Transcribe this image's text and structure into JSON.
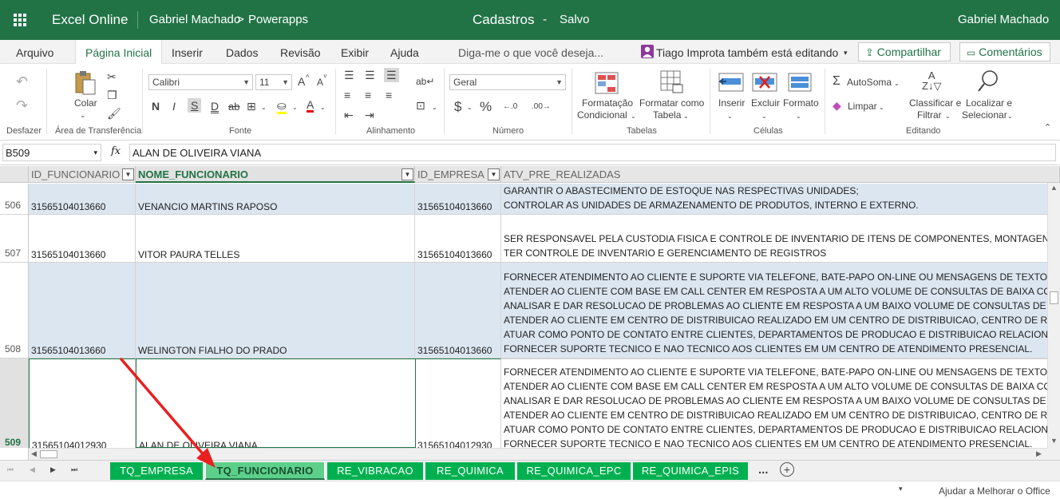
{
  "titlebar": {
    "app_name": "Excel Online",
    "breadcrumb_user": "Gabriel Machado",
    "breadcrumb_sep": ">",
    "breadcrumb_folder": "Powerapps",
    "doc_title": "Cadastros",
    "doc_sep": "-",
    "save_status": "Salvo",
    "user_name": "Gabriel Machado"
  },
  "menu": {
    "items": [
      "Arquivo",
      "Página Inicial",
      "Inserir",
      "Dados",
      "Revisão",
      "Exibir",
      "Ajuda"
    ],
    "search_placeholder": "Diga-me o que você deseja...",
    "coauthor_text": "Tiago Improta também está editando",
    "share_label": "Compartilhar",
    "comments_label": "Comentários"
  },
  "ribbon": {
    "undo_group": "Desfazer",
    "clipboard_group": "Área de Transferência",
    "paste_label": "Colar",
    "font_group": "Fonte",
    "font_name": "Calibri",
    "font_size": "11",
    "bold": "N",
    "italic": "I",
    "underline": "S",
    "double_underline": "D",
    "strike": "ab",
    "grow_font": "A",
    "shrink_font": "A",
    "font_color": "A",
    "alignment_group": "Alinhamento",
    "number_group": "Número",
    "number_format": "Geral",
    "currency": "$",
    "percent": "%",
    "tables_group": "Tabelas",
    "cond_format_l1": "Formatação",
    "cond_format_l2": "Condicional",
    "format_table_l1": "Formatar como",
    "format_table_l2": "Tabela",
    "cells_group": "Células",
    "insert_label": "Inserir",
    "delete_label": "Excluir",
    "format_label": "Formato",
    "editing_group": "Editando",
    "autosum_label": "AutoSoma",
    "clear_label": "Limpar",
    "sort_l1": "Classificar e",
    "sort_l2": "Filtrar",
    "find_l1": "Localizar e",
    "find_l2": "Selecionar"
  },
  "formula": {
    "namebox": "B509",
    "fx": "fx",
    "value": "ALAN DE OLIVEIRA VIANA"
  },
  "grid": {
    "headers": [
      "ID_FUNCIONARIO",
      "NOME_FUNCIONARIO",
      "ID_EMPRESA",
      "ATV_PRE_REALIZADAS"
    ],
    "rows": [
      {
        "num": "506",
        "id": "31565104013660",
        "name": "VENANCIO MARTINS RAPOSO",
        "empresa": "31565104013660",
        "atv": [
          "GARANTIR O ABASTECIMENTO DE ESTOQUE NAS RESPECTIVAS UNIDADES;",
          "CONTROLAR AS UNIDADES DE ARMAZENAMENTO DE PRODUTOS, INTERNO E EXTERNO."
        ]
      },
      {
        "num": "507",
        "id": "31565104013660",
        "name": "VITOR PAURA TELLES",
        "empresa": "31565104013660",
        "atv": [
          "SER RESPONSAVEL PELA CUSTODIA FISICA E CONTROLE DE INVENTARIO DE ITENS DE COMPONENTES, MONTAGENS E/OU",
          "TER CONTROLE DE INVENTARIO E GERENCIAMENTO DE REGISTROS"
        ]
      },
      {
        "num": "508",
        "id": "31565104013660",
        "name": "WELINGTON FIALHO DO PRADO",
        "empresa": "31565104013660",
        "atv": [
          "FORNECER  ATENDIMENTO AO CLIENTE E SUPORTE VIA TELEFONE, BATE-PAPO ON-LINE OU MENSAGENS DE TEXTO;",
          "ATENDER AO CLIENTE COM BASE EM CALL CENTER EM RESPOSTA A UM ALTO VOLUME DE CONSULTAS DE BAIXA COMPL",
          "ANALISAR  E DAR RESOLUCAO DE PROBLEMAS AO CLIENTE EM RESPOSTA A UM BAIXO VOLUME DE CONSULTAS DE CO",
          "ATENDER AO CLIENTE EM CENTRO DE DISTRIBUICAO REALIZADO EM UM CENTRO DE DISTRIBUICAO, CENTRO DE RETOR",
          "ATUAR COMO PONTO DE CONTATO ENTRE CLIENTES, DEPARTAMENTOS DE PRODUCAO E DISTRIBUICAO RELACIONADOS",
          "FORNECER SUPORTE TECNICO E NAO TECNICO AOS CLIENTES EM UM CENTRO DE   ATENDIMENTO PRESENCIAL."
        ]
      },
      {
        "num": "509",
        "id": "31565104012930",
        "name": "ALAN DE OLIVEIRA VIANA",
        "empresa": "31565104012930",
        "atv": [
          "FORNECER  ATENDIMENTO AO CLIENTE E SUPORTE VIA TELEFONE, BATE-PAPO ON-LINE OU MENSAGENS DE TEXTO;",
          "ATENDER AO CLIENTE COM BASE EM CALL CENTER EM RESPOSTA A UM ALTO VOLUME DE CONSULTAS DE BAIXA COMPL",
          "ANALISAR  E DAR RESOLUCAO DE PROBLEMAS AO CLIENTE EM RESPOSTA A UM BAIXO VOLUME DE CONSULTAS DE CO",
          "ATENDER AO CLIENTE EM CENTRO DE DISTRIBUICAO REALIZADO EM UM CENTRO DE DISTRIBUICAO, CENTRO DE RETOR",
          "ATUAR COMO PONTO DE CONTATO ENTRE CLIENTES, DEPARTAMENTOS DE PRODUCAO E DISTRIBUICAO RELACIONADOS",
          "FORNECER SUPORTE TECNICO E NAO TECNICO AOS CLIENTES EM UM CENTRO DE   ATENDIMENTO PRESENCIAL."
        ]
      }
    ]
  },
  "sheets": {
    "tabs": [
      "TQ_EMPRESA",
      "TQ_FUNCIONARIO",
      "RE_VIBRACAO",
      "RE_QUIMICA",
      "RE_QUIMICA_EPC",
      "RE_QUIMICA_EPIS"
    ],
    "active": "TQ_FUNCIONARIO",
    "more": "..."
  },
  "status": {
    "feedback": "Ajudar a Melhorar o Office"
  },
  "colors": {
    "brand_green": "#217346",
    "tab_green": "#00b050",
    "selected_row_bg": "#dce6f1",
    "arrow_red": "#e8201f"
  }
}
